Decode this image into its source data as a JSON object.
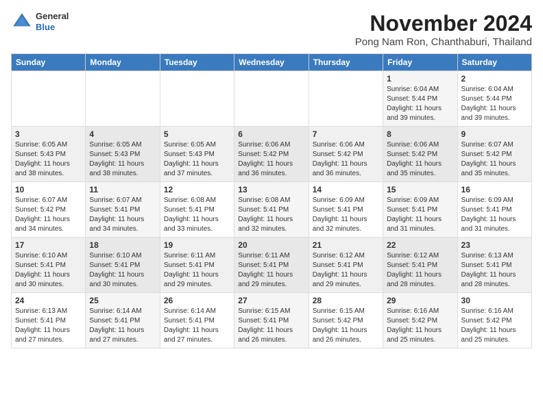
{
  "logo": {
    "general": "General",
    "blue": "Blue"
  },
  "title": "November 2024",
  "location": "Pong Nam Ron, Chanthaburi, Thailand",
  "days_of_week": [
    "Sunday",
    "Monday",
    "Tuesday",
    "Wednesday",
    "Thursday",
    "Friday",
    "Saturday"
  ],
  "weeks": [
    [
      {
        "day": "",
        "info": ""
      },
      {
        "day": "",
        "info": ""
      },
      {
        "day": "",
        "info": ""
      },
      {
        "day": "",
        "info": ""
      },
      {
        "day": "",
        "info": ""
      },
      {
        "day": "1",
        "info": "Sunrise: 6:04 AM\nSunset: 5:44 PM\nDaylight: 11 hours and 39 minutes."
      },
      {
        "day": "2",
        "info": "Sunrise: 6:04 AM\nSunset: 5:44 PM\nDaylight: 11 hours and 39 minutes."
      }
    ],
    [
      {
        "day": "3",
        "info": "Sunrise: 6:05 AM\nSunset: 5:43 PM\nDaylight: 11 hours and 38 minutes."
      },
      {
        "day": "4",
        "info": "Sunrise: 6:05 AM\nSunset: 5:43 PM\nDaylight: 11 hours and 38 minutes."
      },
      {
        "day": "5",
        "info": "Sunrise: 6:05 AM\nSunset: 5:43 PM\nDaylight: 11 hours and 37 minutes."
      },
      {
        "day": "6",
        "info": "Sunrise: 6:06 AM\nSunset: 5:42 PM\nDaylight: 11 hours and 36 minutes."
      },
      {
        "day": "7",
        "info": "Sunrise: 6:06 AM\nSunset: 5:42 PM\nDaylight: 11 hours and 36 minutes."
      },
      {
        "day": "8",
        "info": "Sunrise: 6:06 AM\nSunset: 5:42 PM\nDaylight: 11 hours and 35 minutes."
      },
      {
        "day": "9",
        "info": "Sunrise: 6:07 AM\nSunset: 5:42 PM\nDaylight: 11 hours and 35 minutes."
      }
    ],
    [
      {
        "day": "10",
        "info": "Sunrise: 6:07 AM\nSunset: 5:42 PM\nDaylight: 11 hours and 34 minutes."
      },
      {
        "day": "11",
        "info": "Sunrise: 6:07 AM\nSunset: 5:41 PM\nDaylight: 11 hours and 34 minutes."
      },
      {
        "day": "12",
        "info": "Sunrise: 6:08 AM\nSunset: 5:41 PM\nDaylight: 11 hours and 33 minutes."
      },
      {
        "day": "13",
        "info": "Sunrise: 6:08 AM\nSunset: 5:41 PM\nDaylight: 11 hours and 32 minutes."
      },
      {
        "day": "14",
        "info": "Sunrise: 6:09 AM\nSunset: 5:41 PM\nDaylight: 11 hours and 32 minutes."
      },
      {
        "day": "15",
        "info": "Sunrise: 6:09 AM\nSunset: 5:41 PM\nDaylight: 11 hours and 31 minutes."
      },
      {
        "day": "16",
        "info": "Sunrise: 6:09 AM\nSunset: 5:41 PM\nDaylight: 11 hours and 31 minutes."
      }
    ],
    [
      {
        "day": "17",
        "info": "Sunrise: 6:10 AM\nSunset: 5:41 PM\nDaylight: 11 hours and 30 minutes."
      },
      {
        "day": "18",
        "info": "Sunrise: 6:10 AM\nSunset: 5:41 PM\nDaylight: 11 hours and 30 minutes."
      },
      {
        "day": "19",
        "info": "Sunrise: 6:11 AM\nSunset: 5:41 PM\nDaylight: 11 hours and 29 minutes."
      },
      {
        "day": "20",
        "info": "Sunrise: 6:11 AM\nSunset: 5:41 PM\nDaylight: 11 hours and 29 minutes."
      },
      {
        "day": "21",
        "info": "Sunrise: 6:12 AM\nSunset: 5:41 PM\nDaylight: 11 hours and 29 minutes."
      },
      {
        "day": "22",
        "info": "Sunrise: 6:12 AM\nSunset: 5:41 PM\nDaylight: 11 hours and 28 minutes."
      },
      {
        "day": "23",
        "info": "Sunrise: 6:13 AM\nSunset: 5:41 PM\nDaylight: 11 hours and 28 minutes."
      }
    ],
    [
      {
        "day": "24",
        "info": "Sunrise: 6:13 AM\nSunset: 5:41 PM\nDaylight: 11 hours and 27 minutes."
      },
      {
        "day": "25",
        "info": "Sunrise: 6:14 AM\nSunset: 5:41 PM\nDaylight: 11 hours and 27 minutes."
      },
      {
        "day": "26",
        "info": "Sunrise: 6:14 AM\nSunset: 5:41 PM\nDaylight: 11 hours and 27 minutes."
      },
      {
        "day": "27",
        "info": "Sunrise: 6:15 AM\nSunset: 5:41 PM\nDaylight: 11 hours and 26 minutes."
      },
      {
        "day": "28",
        "info": "Sunrise: 6:15 AM\nSunset: 5:42 PM\nDaylight: 11 hours and 26 minutes."
      },
      {
        "day": "29",
        "info": "Sunrise: 6:16 AM\nSunset: 5:42 PM\nDaylight: 11 hours and 25 minutes."
      },
      {
        "day": "30",
        "info": "Sunrise: 6:16 AM\nSunset: 5:42 PM\nDaylight: 11 hours and 25 minutes."
      }
    ]
  ]
}
